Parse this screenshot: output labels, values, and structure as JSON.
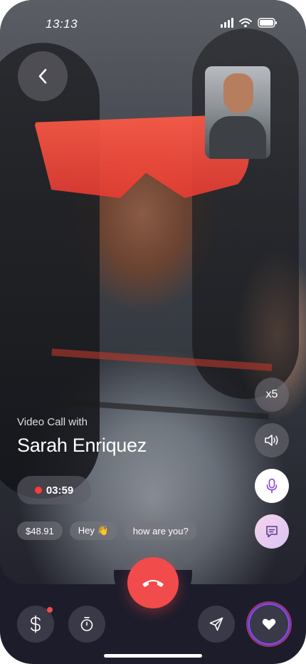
{
  "status_bar": {
    "time": "13:13"
  },
  "call": {
    "caption": "Video Call with",
    "caller_name": "Sarah Enriquez",
    "duration": "03:59",
    "multiplier": "x5"
  },
  "chips": [
    "$48.91",
    "Hey 👋",
    "how are you?"
  ],
  "colors": {
    "end_call": "#f24b4b",
    "bar_bg": "#1d1c2b",
    "recording_dot": "#ff3b3b",
    "nav_button": "#3a3948",
    "favorite_ring": "#7c4dff"
  },
  "icons": {
    "back": "chevron-left-icon",
    "speaker": "speaker-icon",
    "mic": "microphone-icon",
    "chat": "chat-icon",
    "end": "phone-hangup-icon",
    "dollar": "dollar-icon",
    "timer": "stopwatch-icon",
    "send": "send-icon",
    "favorite": "heart-icon"
  }
}
